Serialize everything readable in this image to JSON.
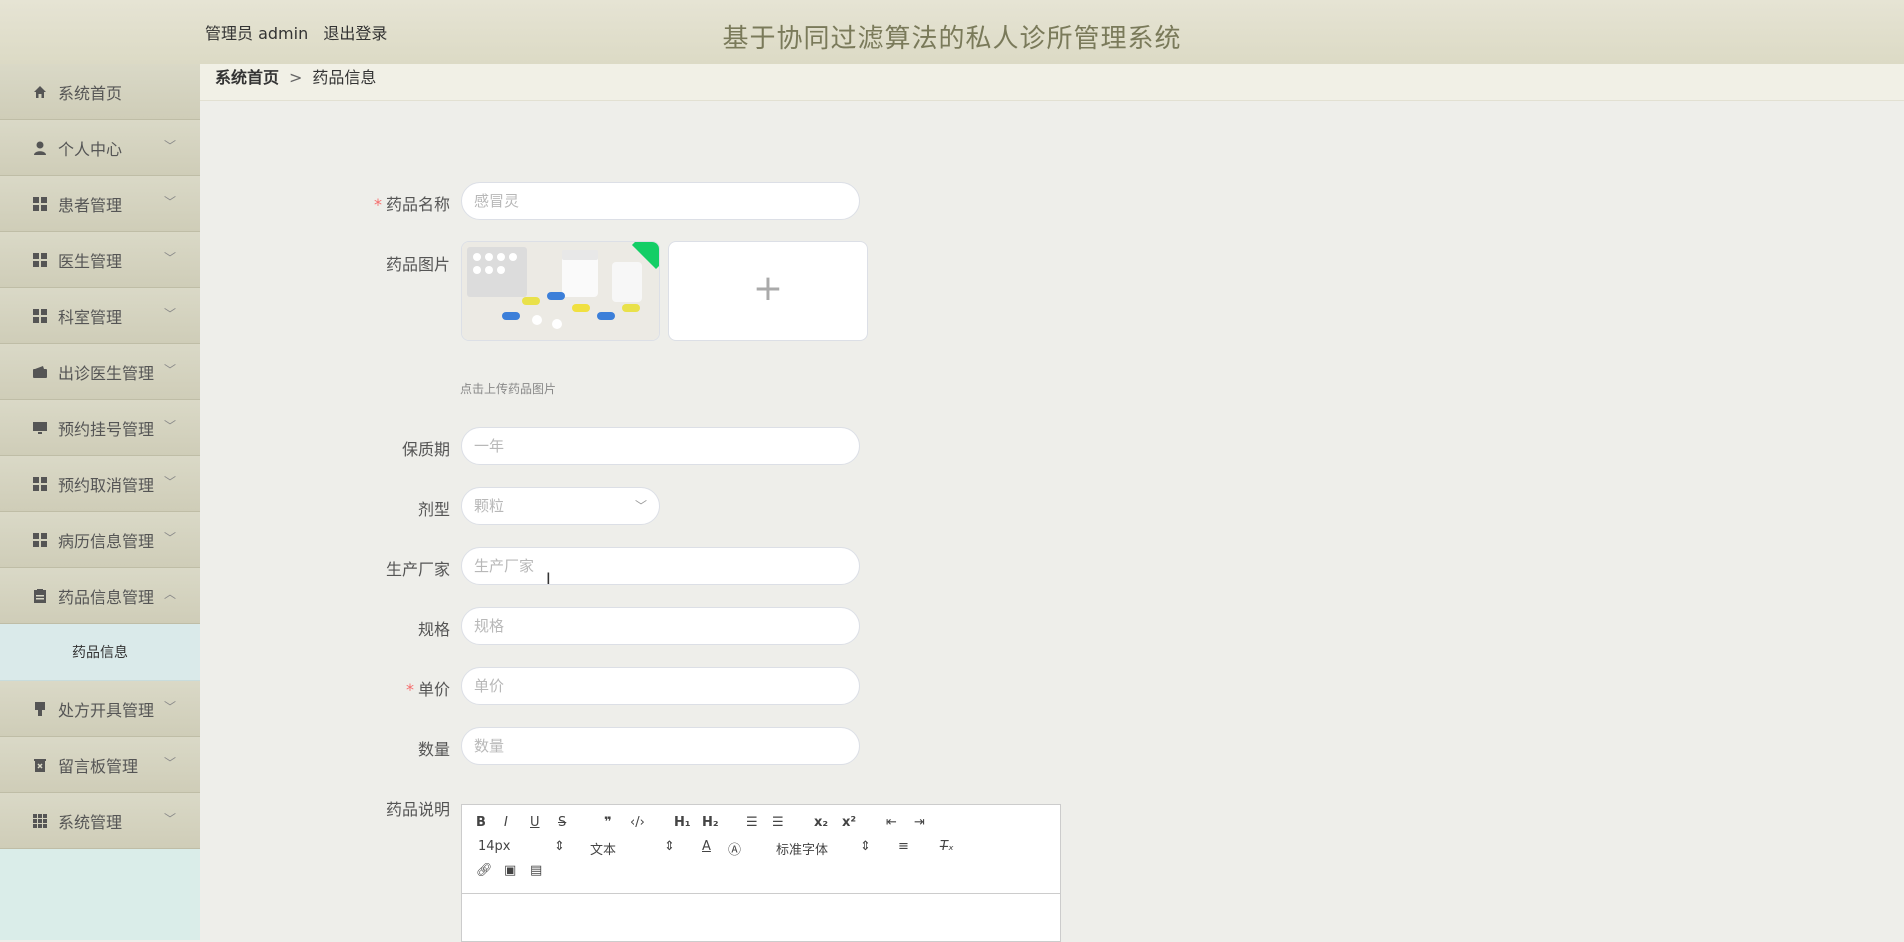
{
  "header": {
    "user_label": "管理员 admin",
    "logout_label": "退出登录",
    "title": "基于协同过滤算法的私人诊所管理系统"
  },
  "sidebar": {
    "items": [
      {
        "label": "系统首页",
        "icon": "home-icon"
      },
      {
        "label": "个人中心",
        "icon": "user-icon"
      },
      {
        "label": "患者管理",
        "icon": "grid-icon"
      },
      {
        "label": "医生管理",
        "icon": "grid-icon"
      },
      {
        "label": "科室管理",
        "icon": "grid-icon"
      },
      {
        "label": "出诊医生管理",
        "icon": "wallet-icon"
      },
      {
        "label": "预约挂号管理",
        "icon": "monitor-icon"
      },
      {
        "label": "预约取消管理",
        "icon": "grid-icon"
      },
      {
        "label": "病历信息管理",
        "icon": "grid-icon"
      },
      {
        "label": "药品信息管理",
        "icon": "clipboard-icon"
      },
      {
        "label": "处方开具管理",
        "icon": "stamp-icon"
      },
      {
        "label": "留言板管理",
        "icon": "trash-icon"
      },
      {
        "label": "系统管理",
        "icon": "apps-icon"
      }
    ],
    "sub_item": "药品信息"
  },
  "breadcrumb": {
    "home": "系统首页",
    "separator": ">",
    "current": "药品信息"
  },
  "form": {
    "name_label": "药品名称",
    "name_placeholder": "感冒灵",
    "image_label": "药品图片",
    "upload_hint": "点击上传药品图片",
    "shelf_label": "保质期",
    "shelf_placeholder": "一年",
    "type_label": "剂型",
    "type_value": "颗粒",
    "maker_label": "生产厂家",
    "maker_placeholder": "生产厂家",
    "spec_label": "规格",
    "spec_placeholder": "规格",
    "price_label": "单价",
    "price_placeholder": "单价",
    "qty_label": "数量",
    "qty_placeholder": "数量",
    "desc_label": "药品说明",
    "required_mark": "*"
  },
  "editor": {
    "font_size": "14px",
    "paragraph": "文本",
    "font_family": "标准字体"
  },
  "colors": {
    "accent_green": "#13ce66",
    "required_red": "#f56c6c"
  }
}
